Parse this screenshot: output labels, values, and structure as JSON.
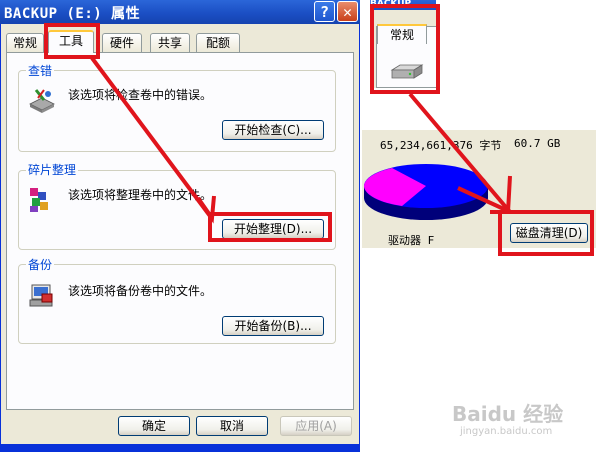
{
  "window": {
    "title": "BACKUP (E:) 属性",
    "help_button": "?",
    "close_button": "✕"
  },
  "tabs": [
    {
      "label": "常规"
    },
    {
      "label": "工具"
    },
    {
      "label": "硬件"
    },
    {
      "label": "共享"
    },
    {
      "label": "配额"
    }
  ],
  "groups": {
    "check": {
      "label": "查错",
      "description": "该选项将检查卷中的错误。",
      "button": "开始检查(C)..."
    },
    "defrag": {
      "label": "碎片整理",
      "description": "该选项将整理卷中的文件。",
      "button": "开始整理(D)..."
    },
    "backup": {
      "label": "备份",
      "description": "该选项将备份卷中的文件。",
      "button": "开始备份(B)..."
    }
  },
  "footer": {
    "ok": "确定",
    "cancel": "取消",
    "apply": "应用(A)"
  },
  "general_window": {
    "title_fragment": "BACKUP",
    "tab": "常规",
    "capacity_bytes": "65,234,661,376 字节",
    "capacity_gb": "60.7 GB",
    "drive_label": "驱动器 F",
    "cleanup_button": "磁盘清理(D)"
  },
  "pie": {
    "used_fraction": 0.2,
    "used_color": "#ff00ff",
    "free_color": "#0000ff"
  },
  "watermark": {
    "brand": "Baidu 经验",
    "url": "jingyan.baidu.com"
  },
  "annotation_color": "#e0141c"
}
